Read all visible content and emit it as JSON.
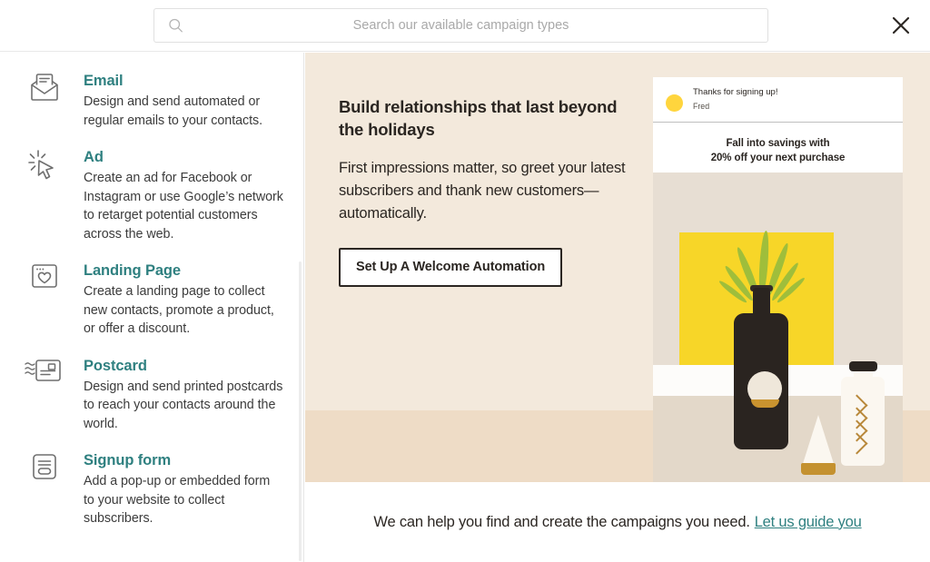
{
  "header": {
    "search": {
      "placeholder": "Search our available campaign types",
      "value": "",
      "icon": "search-icon"
    },
    "close_icon": "close-icon"
  },
  "sidebar": {
    "items": [
      {
        "icon": "envelope-icon",
        "title": "Email",
        "description": "Design and send automated or regular emails to your contacts."
      },
      {
        "icon": "cursor-click-icon",
        "title": "Ad",
        "description": "Create an ad for Facebook or Instagram or use Google’s network to retarget potential customers across the web."
      },
      {
        "icon": "browser-heart-icon",
        "title": "Landing Page",
        "description": "Create a landing page to collect new contacts, promote a product, or offer a discount."
      },
      {
        "icon": "postcard-icon",
        "title": "Postcard",
        "description": "Design and send printed postcards to reach your contacts around the world."
      },
      {
        "icon": "signup-form-icon",
        "title": "Signup form",
        "description": "Add a pop-up or embedded form to your website to collect subscribers."
      }
    ]
  },
  "promo": {
    "headline": "Build relationships that last beyond the holidays",
    "body": "First impressions matter, so greet your latest subscribers and thank new customers—automatically.",
    "cta_label": "Set Up A Welcome Automation",
    "preview": {
      "subject": "Thanks for signing up!",
      "sender": "Fred",
      "promo_line1": "Fall into savings with",
      "promo_line2": "20% off your next purchase",
      "avatar": "yellow-avatar"
    }
  },
  "footer": {
    "text": "We can help you find and create the campaigns you need.",
    "link_label": "Let us guide you"
  },
  "colors": {
    "accent_teal": "#2f8080",
    "promo_background": "#f3e9dc",
    "promo_floor": "#eedcc6",
    "photo_yellow": "#f7d628",
    "avatar_yellow": "#ffd53d",
    "text_dark": "#2b2622"
  }
}
